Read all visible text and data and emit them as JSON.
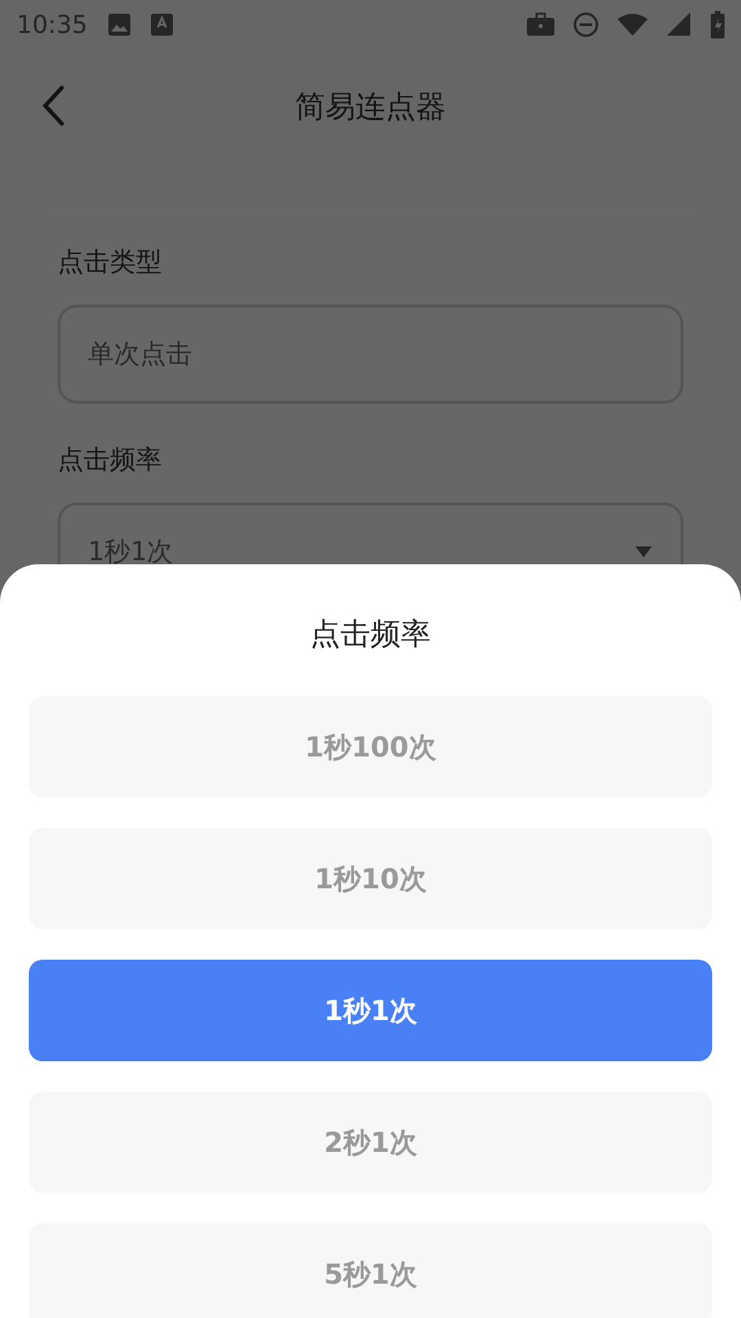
{
  "status_bar": {
    "time": "10:35"
  },
  "header": {
    "title": "简易连点器"
  },
  "form": {
    "fields": [
      {
        "label": "点击类型",
        "value": "单次点击",
        "kind": "text"
      },
      {
        "label": "点击频率",
        "value": "1秒1次",
        "kind": "select"
      }
    ]
  },
  "sheet": {
    "title": "点击频率",
    "options": [
      {
        "label": "1秒100次",
        "selected": false
      },
      {
        "label": "1秒10次",
        "selected": false
      },
      {
        "label": "1秒1次",
        "selected": true
      },
      {
        "label": "2秒1次",
        "selected": false
      },
      {
        "label": "5秒1次",
        "selected": false
      }
    ]
  }
}
